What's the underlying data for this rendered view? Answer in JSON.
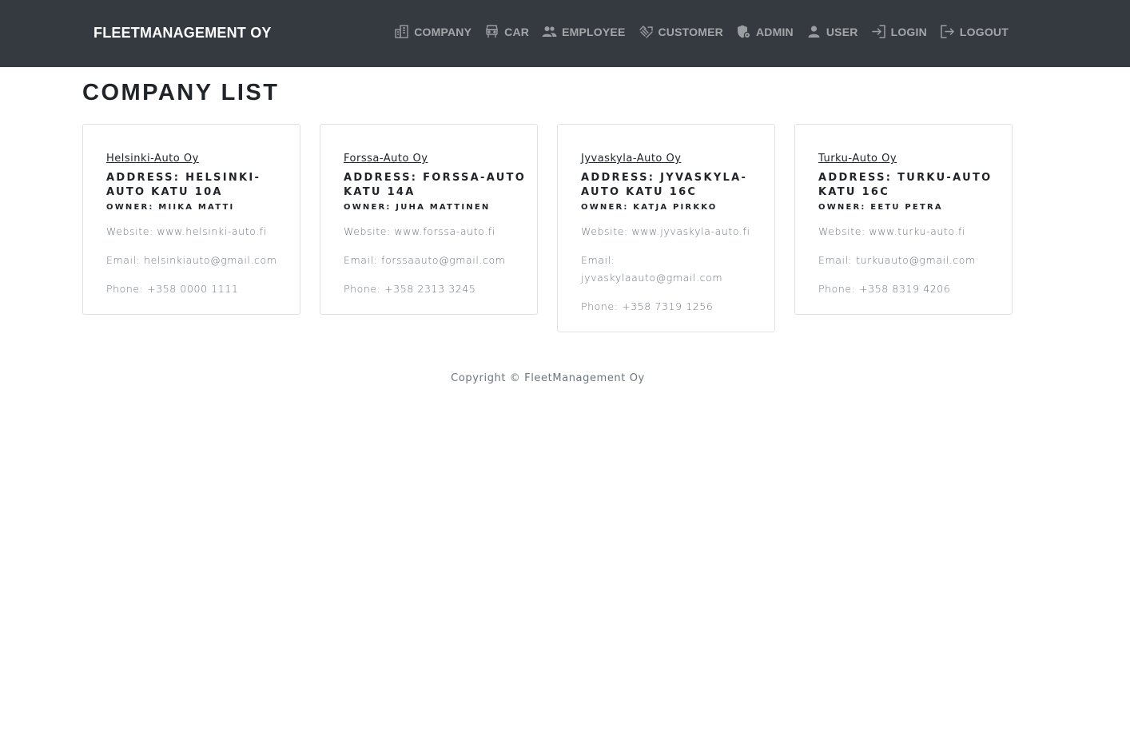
{
  "navbar": {
    "brand": "FLEETMANAGEMENT OY",
    "items": [
      {
        "label": "COMPANY",
        "icon": "building-icon"
      },
      {
        "label": "CAR",
        "icon": "car-icon"
      },
      {
        "label": "EMPLOYEE",
        "icon": "people-icon"
      },
      {
        "label": "CUSTOMER",
        "icon": "handshake-icon"
      },
      {
        "label": "ADMIN",
        "icon": "admin-shield-icon"
      },
      {
        "label": "USER",
        "icon": "person-icon"
      },
      {
        "label": "LOGIN",
        "icon": "login-icon"
      },
      {
        "label": "LOGOUT",
        "icon": "logout-icon"
      }
    ]
  },
  "page": {
    "title": "COMPANY LIST"
  },
  "companies": [
    {
      "name": "Helsinki-Auto Oy",
      "address": "ADDRESS: HELSINKI-AUTO KATU 10A",
      "owner": "OWNER: MIIKA MATTI",
      "website": "Website: www.helsinki-auto.fi",
      "email": "Email: helsinkiauto@gmail.com",
      "phone": "Phone: +358 0000 1111"
    },
    {
      "name": "Forssa-Auto Oy",
      "address": "ADDRESS: FORSSA-AUTO KATU 14A",
      "owner": "OWNER: JUHA MATTINEN",
      "website": "Website: www.forssa-auto.fi",
      "email": "Email: forssaauto@gmail.com",
      "phone": "Phone: +358 2313 3245"
    },
    {
      "name": "Jyvaskyla-Auto Oy",
      "address": "ADDRESS: JYVASKYLA-AUTO KATU 16C",
      "owner": "OWNER: KATJA PIRKKO",
      "website": "Website: www.jyvaskyla-auto.fi",
      "email": "Email: jyvaskylaauto@gmail.com",
      "phone": "Phone: +358 7319 1256"
    },
    {
      "name": "Turku-Auto Oy",
      "address": "ADDRESS: TURKU-AUTO KATU 16C",
      "owner": "OWNER: EETU PETRA",
      "website": "Website: www.turku-auto.fi",
      "email": "Email: turkuauto@gmail.com",
      "phone": "Phone: +358 8319 4206"
    }
  ],
  "footer": {
    "copyright": "Copyright © FleetManagement Oy"
  },
  "colors": {
    "navbar_bg": "#343a40",
    "nav_text": "#9a9da1",
    "heading": "#212529",
    "muted_text": "#6c757d",
    "card_border": "#dee2e6"
  }
}
